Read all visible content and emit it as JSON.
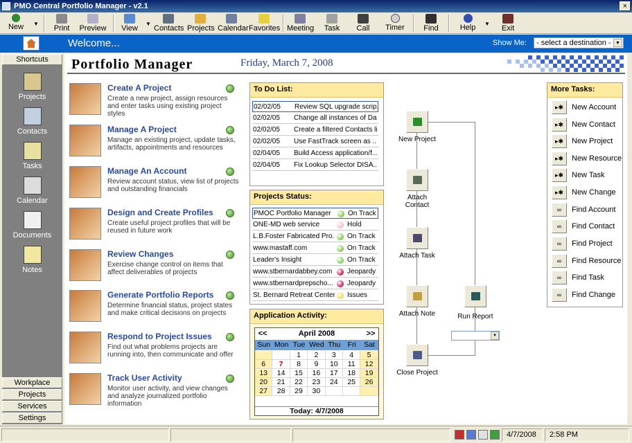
{
  "window": {
    "title": "PMO Central Portfolio Manager - v2.1",
    "close_glyph": "×"
  },
  "toolbar": [
    {
      "label": "New",
      "icon": "new-icon"
    },
    {
      "label": "Print",
      "icon": "print-icon"
    },
    {
      "label": "Preview",
      "icon": "preview-icon"
    },
    {
      "label": "View",
      "icon": "view-icon"
    },
    {
      "label": "Contacts",
      "icon": "contacts-icon"
    },
    {
      "label": "Projects",
      "icon": "projects-icon"
    },
    {
      "label": "Calendar",
      "icon": "calendar-icon"
    },
    {
      "label": "Favorites",
      "icon": "favorites-icon"
    },
    {
      "label": "Meeting",
      "icon": "meeting-icon"
    },
    {
      "label": "Task",
      "icon": "task-icon"
    },
    {
      "label": "Call",
      "icon": "phone-icon"
    },
    {
      "label": "Timer",
      "icon": "timer-icon"
    },
    {
      "label": "Find",
      "icon": "binoculars-icon"
    },
    {
      "label": "Help",
      "icon": "help-icon"
    },
    {
      "label": "Exit",
      "icon": "exit-icon"
    }
  ],
  "welcome": {
    "text": "Welcome...",
    "show_me_label": "Show Me:",
    "destination": "- select a destination -"
  },
  "sidebar": {
    "shortcuts": "Shortcuts",
    "items": [
      "Projects",
      "Contacts",
      "Tasks",
      "Calendar",
      "Documents",
      "Notes"
    ],
    "bottom": [
      "Workplace",
      "Projects",
      "Services",
      "Settings"
    ]
  },
  "header": {
    "title": "Portfolio Manager",
    "date": "Friday, March 7, 2008"
  },
  "tasks": [
    {
      "title": "Create A Project",
      "desc": "Create a new project, assign resources and enter tasks using existing project styles"
    },
    {
      "title": "Manage A Project",
      "desc": "Manage an existing project, update tasks, artifacts, appointments and resources"
    },
    {
      "title": "Manage An Account",
      "desc": "Review account status, view list of projects and outstanding financials"
    },
    {
      "title": "Design and Create Profiles",
      "desc": "Create useful project profiles that will be reused in future work"
    },
    {
      "title": "Review Changes",
      "desc": "Exercise change control on items that affect deliverables of projects"
    },
    {
      "title": "Generate Portfolio Reports",
      "desc": "Determine financial status, project states and make critical decisions on projects"
    },
    {
      "title": "Respond to Project Issues",
      "desc": "Find out what problems projects are running into, then communicate and offer"
    },
    {
      "title": "Track User Activity",
      "desc": "Monitor user activity, and view changes and analyze journalized portfolio information"
    }
  ],
  "todo": {
    "title": "To Do List:",
    "items": [
      {
        "date": "02/02/05",
        "text": "Review SQL upgrade scrip..."
      },
      {
        "date": "02/02/05",
        "text": "Change all instances of Da..."
      },
      {
        "date": "02/02/05",
        "text": "Create a filtered Contacts list"
      },
      {
        "date": "02/02/05",
        "text": "Use FastTrack screen as ..."
      },
      {
        "date": "02/04/05",
        "text": "Build Access application/f..."
      },
      {
        "date": "02/04/05",
        "text": "Fix Lookup Selector DISA..."
      }
    ]
  },
  "status": {
    "title": "Projects Status:",
    "items": [
      {
        "name": "PMOC Portfolio Manager",
        "status": "On Track",
        "color": "#7cc84a"
      },
      {
        "name": "ONE-MD web service",
        "status": "Hold",
        "color": "#f0b8c8"
      },
      {
        "name": "L.B.Foster Fabricated Pro...",
        "status": "On Track",
        "color": "#7cc84a"
      },
      {
        "name": "www.mastaff.com",
        "status": "On Track",
        "color": "#7cc84a"
      },
      {
        "name": "Leader's Insight",
        "status": "On Track",
        "color": "#7cc84a"
      },
      {
        "name": "www.stbernardabbey.com",
        "status": "Jeopardy",
        "color": "#c8145a"
      },
      {
        "name": "www.stbernardprepscho...",
        "status": "Jeopardy",
        "color": "#c8145a"
      },
      {
        "name": "St. Bernard Retreat Center",
        "status": "Issues",
        "color": "#f0d860"
      }
    ]
  },
  "activity": {
    "title": "Application Activity:",
    "prev": "<<",
    "next": ">>",
    "month": "April 2008",
    "days": [
      "Sun",
      "Mon",
      "Tue",
      "Wed",
      "Thu",
      "Fri",
      "Sat"
    ],
    "weeks": [
      [
        "",
        "",
        "1",
        "2",
        "3",
        "4",
        "5"
      ],
      [
        "6",
        "7",
        "8",
        "9",
        "10",
        "11",
        "12"
      ],
      [
        "13",
        "14",
        "15",
        "16",
        "17",
        "18",
        "19"
      ],
      [
        "20",
        "21",
        "22",
        "23",
        "24",
        "25",
        "26"
      ],
      [
        "27",
        "28",
        "29",
        "30",
        "",
        "",
        ""
      ]
    ],
    "today": "Today: 4/7/2008"
  },
  "flow": {
    "new_project": "New Project",
    "attach_contact": "Attach Contact",
    "attach_task": "Attach Task",
    "attach_note": "Attach Note",
    "close_project": "Close Project",
    "run_report": "Run Report"
  },
  "more_tasks": {
    "title": "More Tasks:",
    "items": [
      "New Account",
      "New Contact",
      "New Project",
      "New Resource",
      "New Task",
      "New Change",
      "Find Account",
      "Find Contact",
      "Find Project",
      "Find Resource",
      "Find Task",
      "Find Change"
    ]
  },
  "statusbar": {
    "date": "4/7/2008",
    "time": "2:58 PM"
  }
}
